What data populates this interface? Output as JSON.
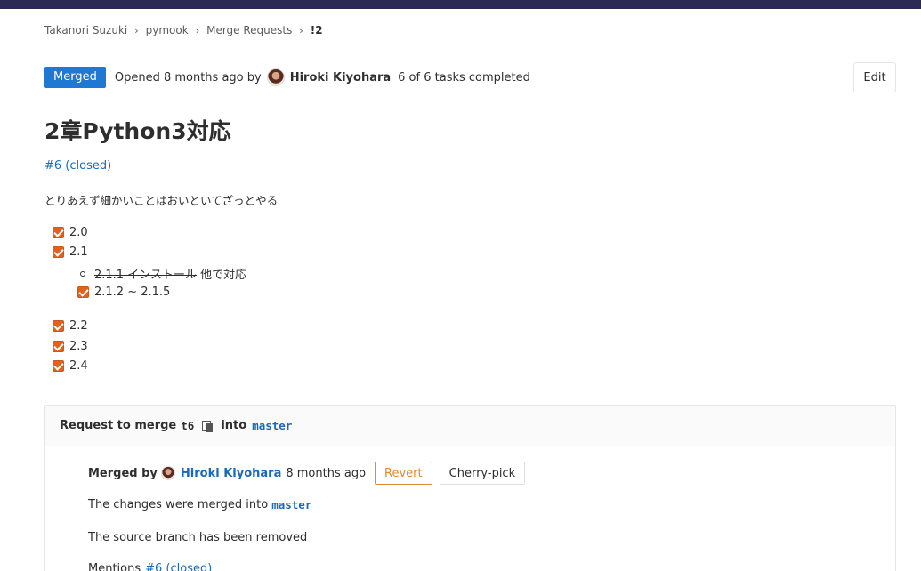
{
  "breadcrumb": {
    "user": "Takanori Suzuki",
    "project": "pymook",
    "section": "Merge Requests",
    "current": "!2"
  },
  "header": {
    "status": "Merged",
    "opened_text": "Opened 8 months ago by",
    "author": "Hiroki Kiyohara",
    "tasks": "6 of 6 tasks completed",
    "edit_label": "Edit"
  },
  "title": "2章Python3対応",
  "issue_link": "#6 (closed)",
  "description": "とりあえず細かいことはおいといてざっとやる",
  "tasks": {
    "t1": "2.0",
    "t2": "2.1",
    "t2_sub1_strike": "2.1.1 インストール",
    "t2_sub1_rest": " 他で対応",
    "t2_sub2": "2.1.2 ~ 2.1.5",
    "t3": "2.2",
    "t4": "2.3",
    "t5": "2.4"
  },
  "merge_box": {
    "request_prefix": "Request to merge",
    "source_branch": "t6",
    "into": "into",
    "target_branch": "master",
    "merged_by_label": "Merged by",
    "merged_by_user": "Hiroki Kiyohara",
    "merged_time": "8 months ago",
    "revert_label": "Revert",
    "cherry_pick_label": "Cherry-pick",
    "changes_text": "The changes were merged into",
    "changes_branch": "master",
    "source_removed": "The source branch has been removed",
    "mentions_label": "Mentions",
    "mentions_link": "#6 (closed)"
  },
  "colors": {
    "topbar": "#2b2a55",
    "merged_badge": "#1f78d1",
    "link": "#1b69b6",
    "checkbox": "#e1621b",
    "revert": "#e08b32"
  }
}
